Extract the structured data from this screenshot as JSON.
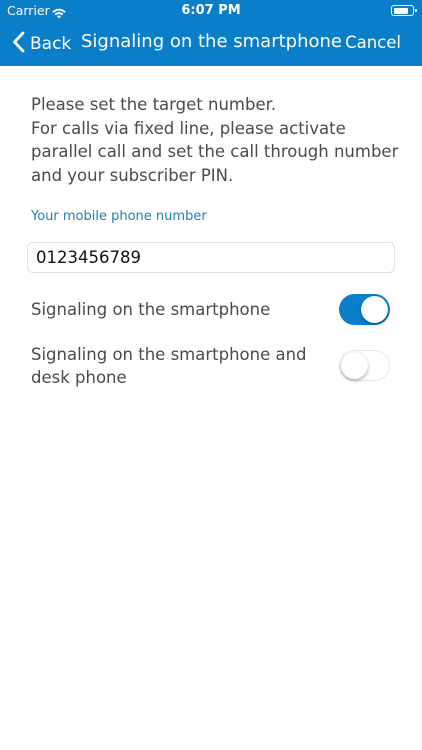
{
  "status_bar": {
    "carrier": "Carrier",
    "time": "6:07 PM",
    "battery_level": 0.8
  },
  "nav": {
    "back_label": "Back",
    "title": "Signaling on the smartphone",
    "cancel_label": "Cancel"
  },
  "instructions": [
    "Please set the target number.",
    "For calls via fixed line, please activate",
    "parallel call and set the call through number",
    "and your subscriber PIN."
  ],
  "phone_field": {
    "label": "Your mobile phone number",
    "value": "0123456789"
  },
  "toggles": [
    {
      "label_lines": [
        "Signaling on the smartphone"
      ],
      "on": true
    },
    {
      "label_lines": [
        "Signaling on the smartphone and",
        "desk phone"
      ],
      "on": false
    }
  ],
  "colors": {
    "accent": "#0a7ec8",
    "field_label": "#1f7fb0",
    "body_text": "#4a4a4a"
  }
}
